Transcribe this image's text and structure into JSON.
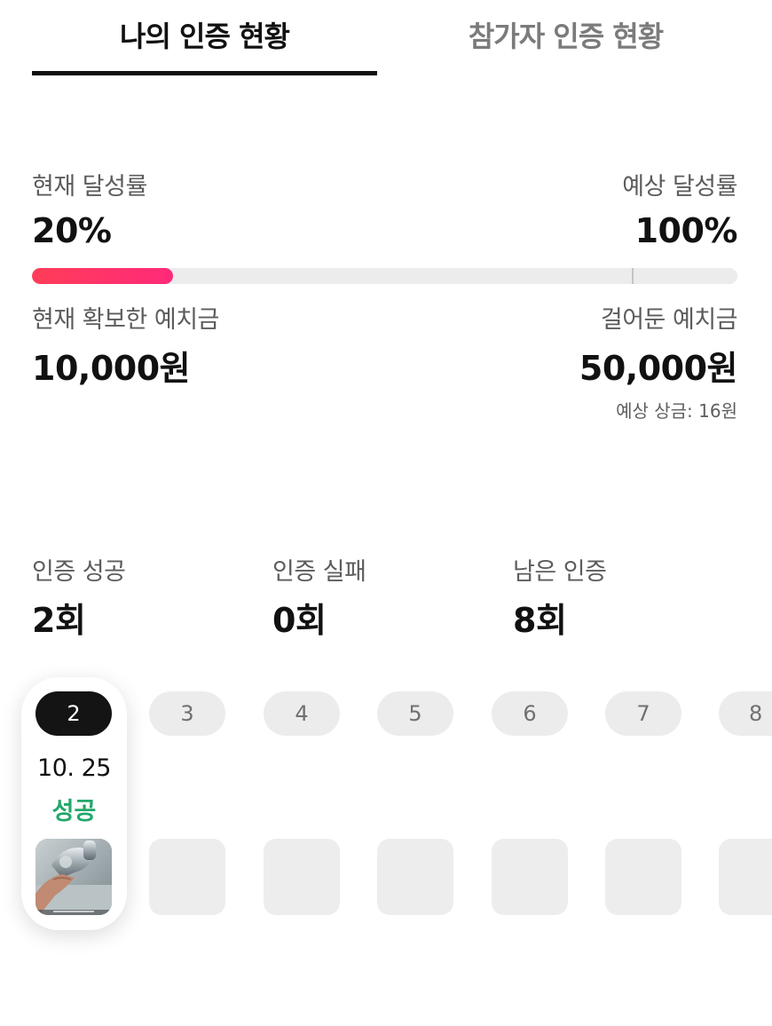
{
  "tabs": [
    {
      "label": "나의 인증 현황",
      "active": true
    },
    {
      "label": "참가자 인증 현황",
      "active": false
    }
  ],
  "achievement": {
    "current_label": "현재 달성률",
    "current_value": "20%",
    "expected_label": "예상 달성률",
    "expected_value": "100%",
    "progress_fraction": 0.2,
    "expected_marker_fraction": 0.85
  },
  "deposit": {
    "secured_label": "현재 확보한 예치금",
    "secured_value": "10,000원",
    "staked_label": "걸어둔 예치금",
    "staked_value": "50,000원",
    "expected_prize": "예상 상금: 16원"
  },
  "stats": {
    "success_label": "인증 성공",
    "success_value": "2회",
    "fail_label": "인증 실패",
    "fail_value": "0회",
    "remaining_label": "남은 인증",
    "remaining_value": "8회"
  },
  "days": [
    {
      "num": "2",
      "date": "10. 25",
      "status": "성공",
      "active": true
    },
    {
      "num": "3"
    },
    {
      "num": "4"
    },
    {
      "num": "5"
    },
    {
      "num": "6"
    },
    {
      "num": "7"
    },
    {
      "num": "8"
    }
  ],
  "colors": {
    "progress_start": "#ff3d58",
    "progress_end": "#ff2a7a",
    "success_green": "#22a86a",
    "active_pill": "#141414",
    "inactive_pill": "#ececec"
  }
}
